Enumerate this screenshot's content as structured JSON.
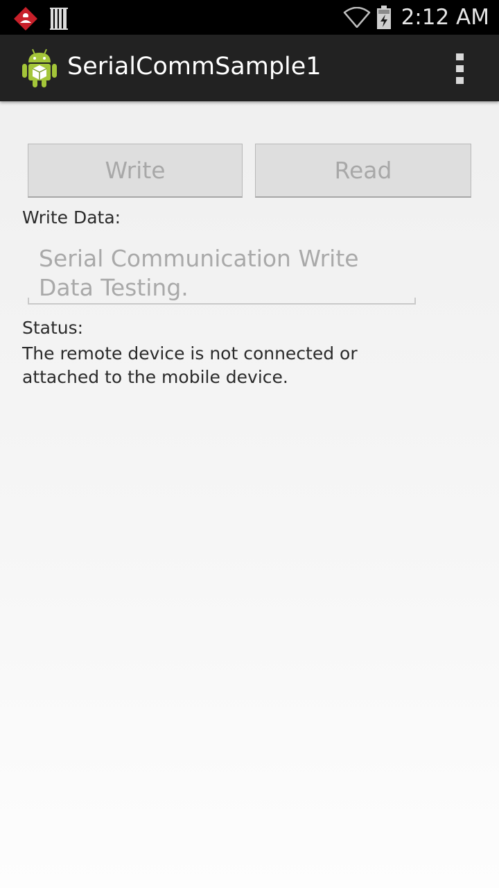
{
  "status_bar": {
    "notification_icons": [
      "red-diamond-app-icon",
      "barcode-scanner-icon"
    ],
    "system_icons": [
      "wifi-icon",
      "battery-charging-icon"
    ],
    "clock": "2:12 AM"
  },
  "action_bar": {
    "app_icon": "android-robot-icon",
    "title": "SerialCommSample1",
    "overflow_icon": "overflow-menu-icon"
  },
  "buttons": {
    "write_label": "Write",
    "read_label": "Read"
  },
  "write_data": {
    "label": "Write Data:",
    "value": "Serial Communication Write Data Testing."
  },
  "status": {
    "label": "Status:",
    "message": "The remote device is not connected or attached to the mobile device."
  },
  "colors": {
    "status_bar_bg": "#000000",
    "action_bar_bg": "#222222",
    "button_bg": "#dedede",
    "disabled_text": "#a8a8a8"
  }
}
